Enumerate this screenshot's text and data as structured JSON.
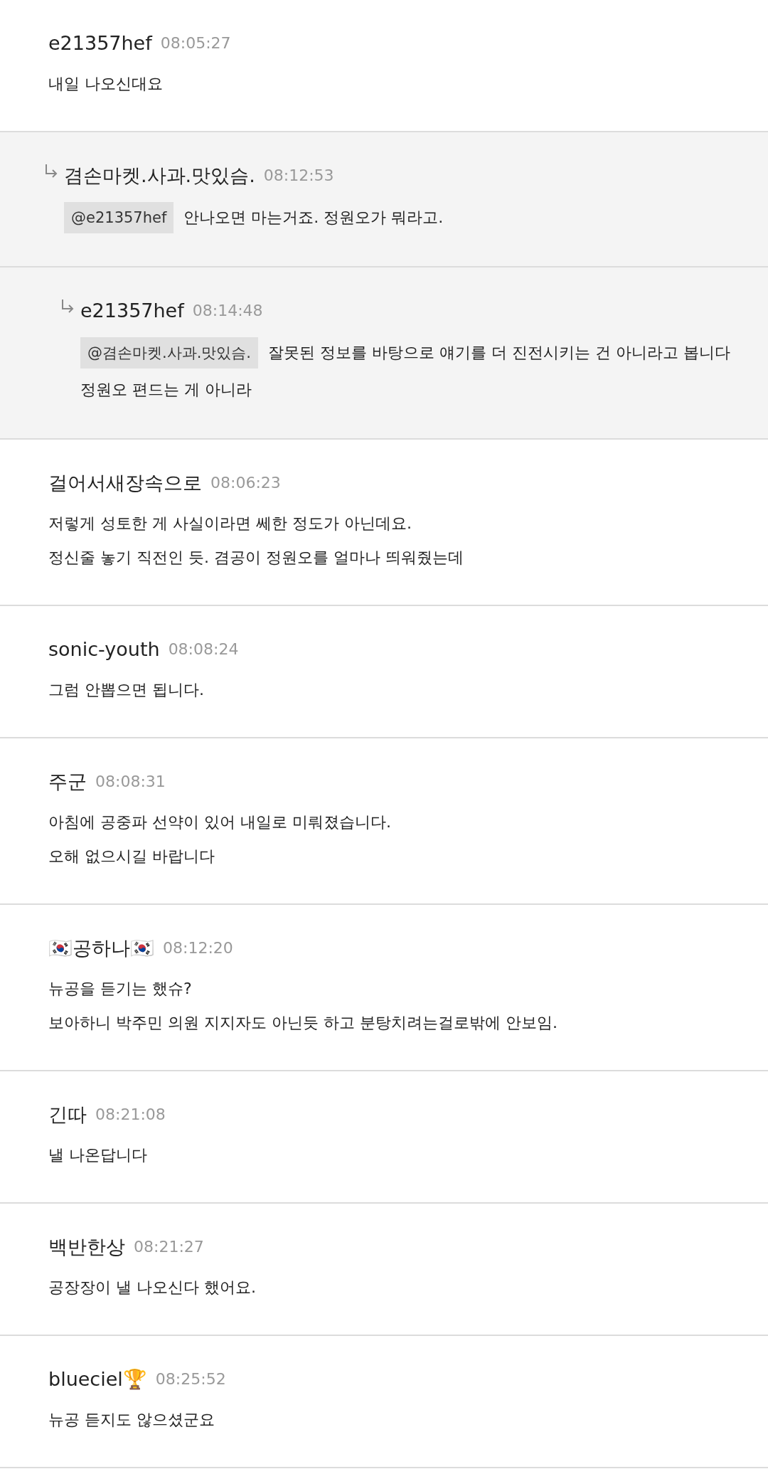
{
  "comments": [
    {
      "author": "e21357hef",
      "time": "08:05:27",
      "lines": [
        "내일 나오신대요"
      ],
      "children": [
        {
          "author": "겸손마켓.사과.맛있슴.",
          "time": "08:12:53",
          "mention": "@e21357hef",
          "lines": [
            "안나오면 마는거죠. 정원오가 뭐라고."
          ],
          "children": [
            {
              "author": "e21357hef",
              "time": "08:14:48",
              "mention": "@겸손마켓.사과.맛있슴.",
              "lines": [
                "잘못된 정보를 바탕으로 얘기를 더 진전시키는 건 아니라고 봅니다",
                "정원오 편드는 게 아니라"
              ]
            }
          ]
        }
      ]
    },
    {
      "author": "걸어서새장속으로",
      "time": "08:06:23",
      "lines": [
        "저렇게 성토한 게 사실이라면 쎄한 정도가 아닌데요.",
        "정신줄 놓기 직전인 듯. 겸공이 정원오를 얼마나 띄워줬는데"
      ]
    },
    {
      "author": "sonic-youth",
      "time": "08:08:24",
      "lines": [
        "그럼 안뽑으면 됩니다."
      ]
    },
    {
      "author": "주군",
      "time": "08:08:31",
      "lines": [
        "아침에 공중파 선약이 있어 내일로 미뤄졌습니다.",
        "오해 없으시길 바랍니다"
      ]
    },
    {
      "author": "🇰🇷공하나🇰🇷",
      "time": "08:12:20",
      "lines": [
        "뉴공을 듣기는 했슈?",
        "보아하니 박주민 의원 지지자도 아닌듯 하고 분탕치려는걸로밖에 안보임."
      ]
    },
    {
      "author": "긴따",
      "time": "08:21:08",
      "lines": [
        "낼 나온답니다"
      ]
    },
    {
      "author": "백반한상",
      "time": "08:21:27",
      "lines": [
        "공장장이 낼 나오신다 했어요."
      ]
    },
    {
      "author": "blueciel🏆",
      "time": "08:25:52",
      "lines": [
        "뉴공 듣지도 않으셨군요"
      ]
    }
  ]
}
